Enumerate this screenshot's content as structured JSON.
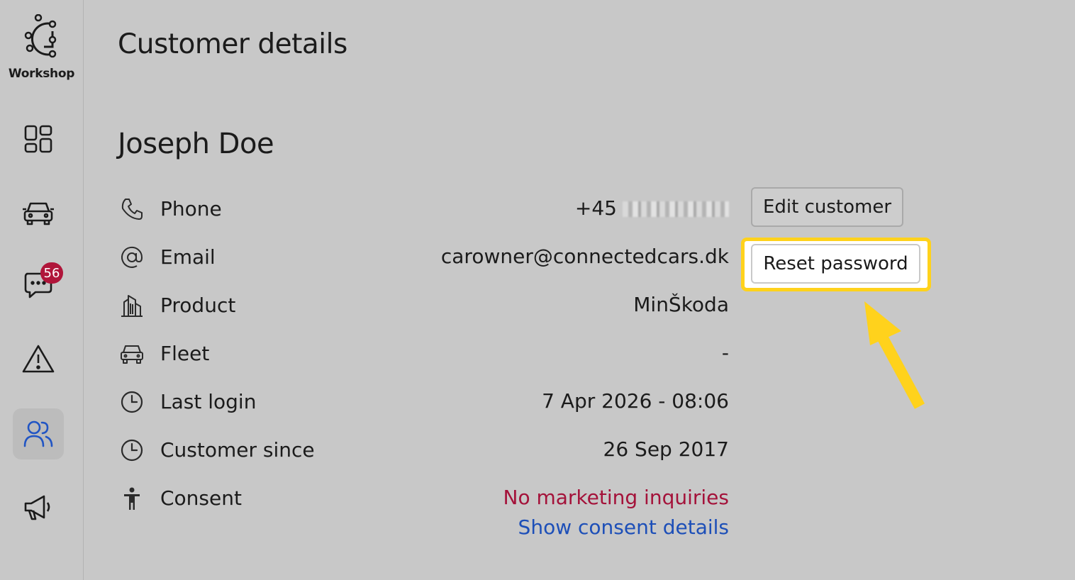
{
  "brand": {
    "label": "Workshop"
  },
  "sidebar": {
    "items": [
      {
        "name": "dashboard",
        "icon": "grid-icon"
      },
      {
        "name": "vehicles",
        "icon": "car-icon"
      },
      {
        "name": "messages",
        "icon": "chat-icon",
        "badge": "56"
      },
      {
        "name": "alerts",
        "icon": "warning-icon"
      },
      {
        "name": "customers",
        "icon": "users-icon",
        "active": true
      },
      {
        "name": "marketing",
        "icon": "megaphone-icon"
      }
    ]
  },
  "header": {
    "title": "Customer details"
  },
  "customer": {
    "name": "Joseph Doe",
    "fields": {
      "phone": {
        "label": "Phone",
        "value": "+45",
        "icon": "phone-icon"
      },
      "email": {
        "label": "Email",
        "value": "carowner@connectedcars.dk",
        "icon": "at-icon"
      },
      "product": {
        "label": "Product",
        "value": "MinŠkoda",
        "icon": "building-icon"
      },
      "fleet": {
        "label": "Fleet",
        "value": "-",
        "icon": "car-icon"
      },
      "last_login": {
        "label": "Last login",
        "value": "7 Apr 2026 - 08:06",
        "icon": "clock-icon"
      },
      "customer_since": {
        "label": "Customer since",
        "value": "26 Sep 2017",
        "icon": "clock-icon"
      },
      "consent": {
        "label": "Consent",
        "value": "No marketing inquiries",
        "link": "Show consent details",
        "icon": "person-icon"
      }
    }
  },
  "actions": {
    "edit_label": "Edit customer",
    "reset_label": "Reset password"
  },
  "colors": {
    "background": "#c8c8c8",
    "badge": "#b0153a",
    "consent_red": "#a4123a",
    "link_blue": "#1d4fb8",
    "highlight_yellow": "#ffd21c",
    "active_nav_icon": "#2155c4"
  }
}
